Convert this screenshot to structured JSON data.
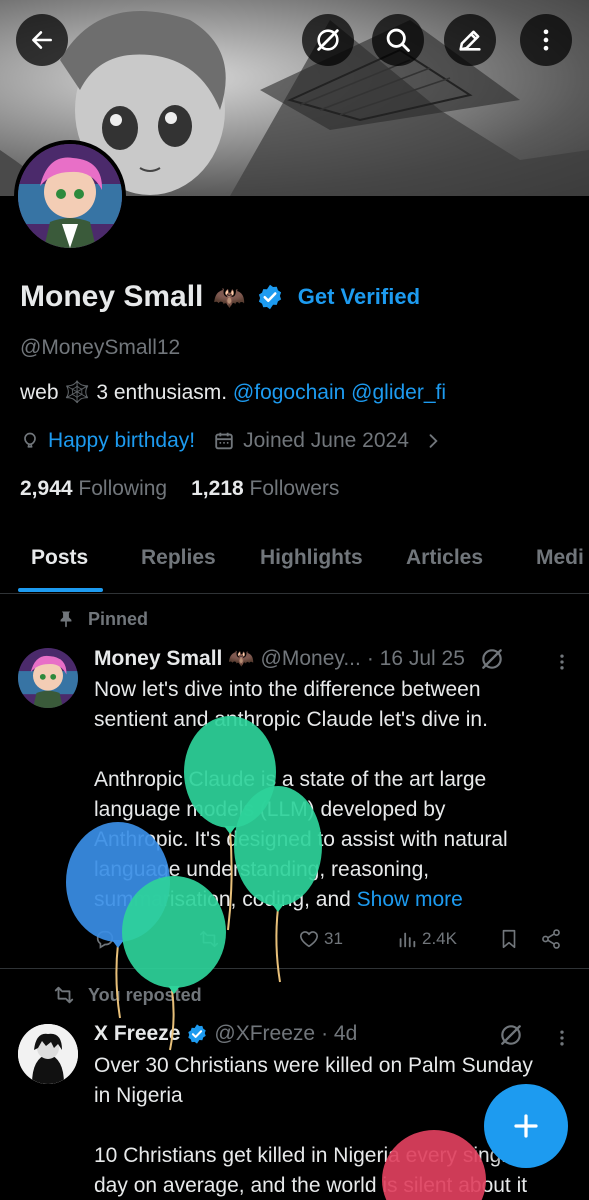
{
  "header": {
    "back_icon": "arrow-left-icon",
    "grok_icon": "slash-circle-icon",
    "search_icon": "search-icon",
    "edit_icon": "compose-icon",
    "more_icon": "more-vertical-icon"
  },
  "profile": {
    "name": "Money Small",
    "name_emoji": "🦇",
    "get_verified": "Get Verified",
    "handle": "@MoneySmall12",
    "bio_prefix": "web ",
    "bio_emoji": "🕸️",
    "bio_middle": " 3 enthusiasm. ",
    "bio_link1": "@fogochain",
    "bio_link2": "@glider_fi",
    "birthday": "Happy birthday!",
    "joined": "Joined June 2024",
    "following_count": "2,944",
    "following_label": "Following",
    "followers_count": "1,218",
    "followers_label": "Followers"
  },
  "tabs": [
    "Posts",
    "Replies",
    "Highlights",
    "Articles",
    "Medi"
  ],
  "post1": {
    "context": "Pinned",
    "name": "Money Small",
    "name_emoji": "🦇",
    "handle": "@Money...",
    "date": "· 16 Jul 25",
    "line1": "Now let's dive into the difference between",
    "line2": "sentient and anthropic Claude let's dive in.",
    "line3": "Anthropic Claude is a state of the art large",
    "line4": "language models (LLM) developed by",
    "line5": "Anthropic. It's designed to assist with natural",
    "line6": "language understanding, reasoning,",
    "line7": "summarisation, coding, and ",
    "show_more": "Show more",
    "likes": "31",
    "views": "2.4K"
  },
  "post2": {
    "context": "You reposted",
    "name": "X Freeze",
    "handle": "@XFreeze",
    "date": "· 4d",
    "line1": "Over 30 Christians were killed on Palm Sunday",
    "line2": "in Nigeria",
    "line3": "10 Christians get killed in Nigeria every single",
    "line4": "day on average, and the world is silent about it"
  },
  "colors": {
    "accent": "#1d9bf0",
    "muted": "#71767b",
    "text": "#e7e9ea",
    "background": "#000000",
    "balloon_green": "#2ed39a",
    "balloon_blue": "#3a8ee6",
    "balloon_red": "#e0405e"
  }
}
